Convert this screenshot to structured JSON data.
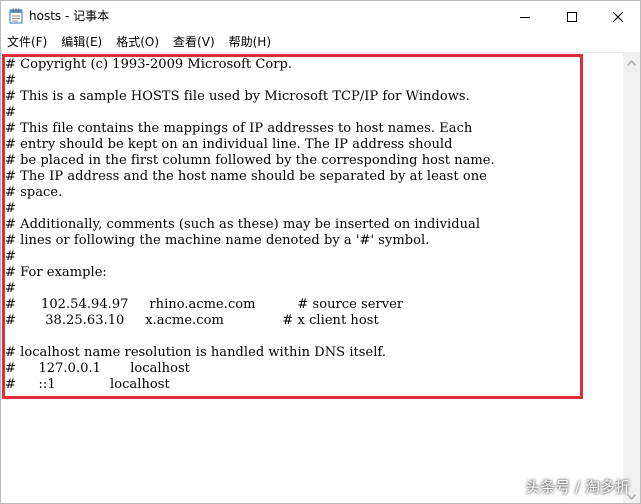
{
  "window": {
    "title": "hosts - 记事本"
  },
  "menu": {
    "items": [
      {
        "label": "文件(F)"
      },
      {
        "label": "编辑(E)"
      },
      {
        "label": "格式(O)"
      },
      {
        "label": "查看(V)"
      },
      {
        "label": "帮助(H)"
      }
    ]
  },
  "editor": {
    "lines": [
      "# Copyright (c) 1993-2009 Microsoft Corp.",
      "#",
      "# This is a sample HOSTS file used by Microsoft TCP/IP for Windows.",
      "#",
      "# This file contains the mappings of IP addresses to host names. Each",
      "# entry should be kept on an individual line. The IP address should",
      "# be placed in the first column followed by the corresponding host name.",
      "# The IP address and the host name should be separated by at least one",
      "# space.",
      "#",
      "# Additionally, comments (such as these) may be inserted on individual",
      "# lines or following the machine name denoted by a '#' symbol.",
      "#",
      "# For example:",
      "#",
      "#      102.54.94.97     rhino.acme.com          # source server",
      "#       38.25.63.10     x.acme.com              # x client host",
      "",
      "# localhost name resolution is handled within DNS itself.",
      "#\t127.0.0.1       localhost",
      "#\t::1             localhost"
    ]
  },
  "watermark": {
    "text": "头条号 / 淘多折"
  },
  "icons": {
    "app": "notepad-icon",
    "minimize": "minimize-icon",
    "maximize": "maximize-icon",
    "close": "close-icon"
  },
  "colors": {
    "highlight_border": "#e12d39"
  }
}
